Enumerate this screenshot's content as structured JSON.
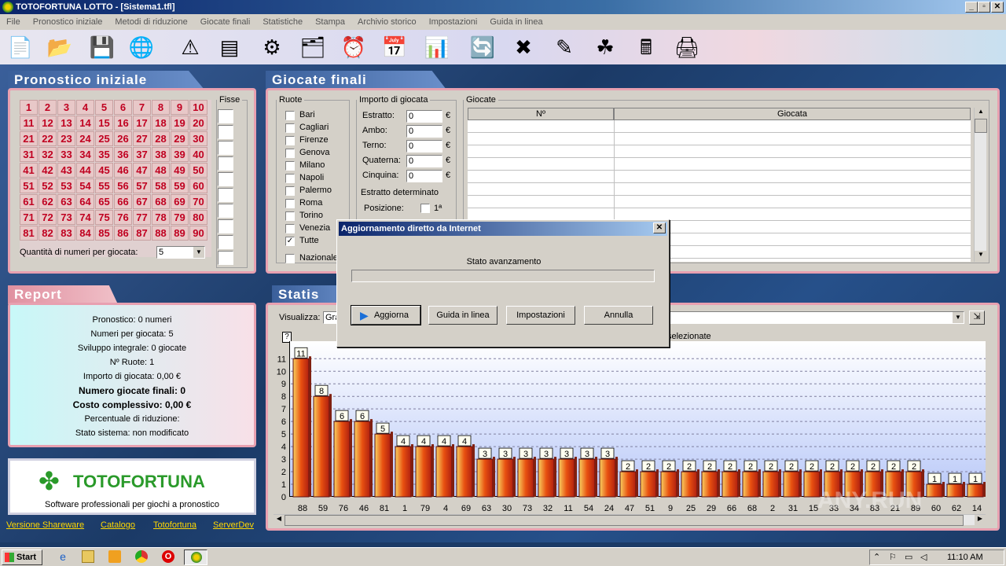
{
  "window": {
    "title": "TOTOFORTUNA LOTTO - [Sistema1.tfl]",
    "min": "_",
    "max": "▫",
    "close": "✕"
  },
  "menu": [
    "File",
    "Pronostico iniziale",
    "Metodi di riduzione",
    "Giocate finali",
    "Statistiche",
    "Stampa",
    "Archivio storico",
    "Impostazioni",
    "Guida in linea"
  ],
  "toolbar": [
    "document-icon",
    "folder-icon",
    "disk-icon",
    "globe-icon",
    "network-icon",
    "server-icon",
    "gears-icon",
    "cards-icon",
    "clock-icon",
    "calendar-icon",
    "chart-icon",
    "refresh-icon",
    "delete-icon",
    "edit-icon",
    "clover-icon",
    "calculator-icon",
    "printer-icon"
  ],
  "pronostico": {
    "title": "Pronostico iniziale",
    "fisse_label": "Fisse",
    "qty_label": "Quantità di numeri per giocata:",
    "qty_value": "5"
  },
  "giocate": {
    "title": "Giocate finali",
    "ruote_legend": "Ruote",
    "ruote": [
      "Bari",
      "Cagliari",
      "Firenze",
      "Genova",
      "Milano",
      "Napoli",
      "Palermo",
      "Roma",
      "Torino",
      "Venezia",
      "Tutte"
    ],
    "nazionale": "Nazionale",
    "importo_legend": "Importo di giocata",
    "importi": [
      {
        "label": "Estratto:",
        "value": "0"
      },
      {
        "label": "Ambo:",
        "value": "0"
      },
      {
        "label": "Terno:",
        "value": "0"
      },
      {
        "label": "Quaterna:",
        "value": "0"
      },
      {
        "label": "Cinquina:",
        "value": "0"
      }
    ],
    "currency": "€",
    "estratto_legend": "Estratto determinato",
    "posizione_label": "Posizione:",
    "posizione_first": "1ª",
    "giocate_legend": "Giocate",
    "col_n": "Nº",
    "col_giocata": "Giocata"
  },
  "report": {
    "title": "Report",
    "lines": [
      {
        "text": "Pronostico: 0 numeri",
        "bold": false
      },
      {
        "text": "Numeri per giocata: 5",
        "bold": false
      },
      {
        "text": "Sviluppo integrale: 0 giocate",
        "bold": false
      },
      {
        "text": "Nº Ruote: 1",
        "bold": false
      },
      {
        "text": "Importo di giocata: 0,00 €",
        "bold": false
      },
      {
        "text": "Numero giocate finali: 0",
        "bold": true
      },
      {
        "text": "Costo complessivo: 0,00 €",
        "bold": true
      },
      {
        "text": "Percentuale di riduzione:",
        "bold": false
      },
      {
        "text": "Stato sistema: non modificato",
        "bold": false
      }
    ]
  },
  "brand": {
    "name": "TOTOFORTUNA",
    "tagline": "Software professionali per giochi a pronostico"
  },
  "links": [
    "Versione Shareware",
    "Catalogo",
    "Totofortuna",
    "ServerDev"
  ],
  "statistiche": {
    "title": "Statis",
    "visualizza_label": "Visualizza:",
    "visualizza_value": "Gra",
    "selected_text": "selezionate",
    "help": "?"
  },
  "chart_data": {
    "type": "bar",
    "categories": [
      "88",
      "59",
      "76",
      "46",
      "81",
      "1",
      "79",
      "4",
      "69",
      "63",
      "30",
      "73",
      "32",
      "11",
      "54",
      "24",
      "47",
      "51",
      "9",
      "25",
      "29",
      "66",
      "68",
      "2",
      "31",
      "15",
      "33",
      "34",
      "83",
      "21",
      "89",
      "60",
      "62",
      "14"
    ],
    "values": [
      11,
      8,
      6,
      6,
      5,
      4,
      4,
      4,
      4,
      3,
      3,
      3,
      3,
      3,
      3,
      3,
      2,
      2,
      2,
      2,
      2,
      2,
      2,
      2,
      2,
      2,
      2,
      2,
      2,
      2,
      2,
      1,
      1,
      1
    ],
    "ylim": [
      0,
      11
    ],
    "yticks": [
      "0",
      "1",
      "2",
      "3",
      "4",
      "5",
      "6",
      "7",
      "8",
      "9",
      "10",
      "11"
    ],
    "grid": true
  },
  "dialog": {
    "title": "Aggiornamento diretto da Internet",
    "status_label": "Stato avanzamento",
    "progress": 0,
    "buttons": [
      "Aggiorna",
      "Guida in linea",
      "Impostazioni",
      "Annulla"
    ]
  },
  "taskbar": {
    "start": "Start",
    "clock": "11:10 AM"
  },
  "watermark": "ANY.RUN"
}
